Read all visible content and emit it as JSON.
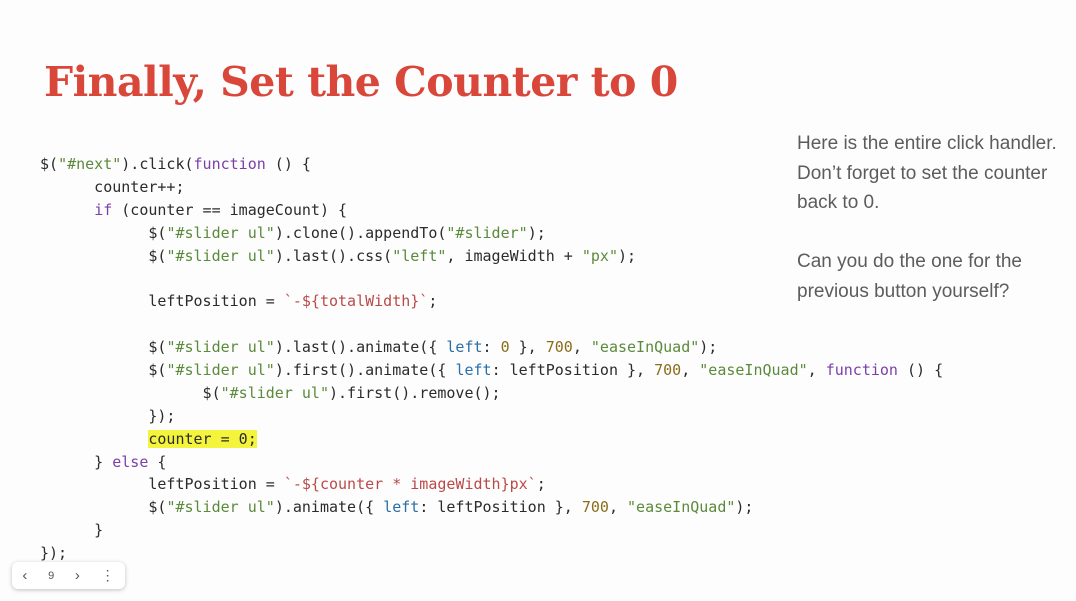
{
  "slide": {
    "title": "Finally, Set the Counter to 0",
    "sidenote": [
      "Here is the entire click handler. Don’t forget to set the counter back to 0.",
      "Can you do the one for the previous button yourself?"
    ],
    "colors": {
      "title": "#d9473a",
      "highlight": "#f4f43c"
    }
  },
  "code": {
    "lines": [
      [
        {
          "t": "$("
        },
        {
          "t": "\"#next\"",
          "c": "str"
        },
        {
          "t": ").click("
        },
        {
          "t": "function",
          "c": "kw"
        },
        {
          "t": " () {"
        }
      ],
      [
        {
          "t": "      counter++;"
        }
      ],
      [
        {
          "t": "      "
        },
        {
          "t": "if",
          "c": "kw"
        },
        {
          "t": " (counter == imageCount) {"
        }
      ],
      [
        {
          "t": "            $("
        },
        {
          "t": "\"#slider ul\"",
          "c": "str"
        },
        {
          "t": ").clone().appendTo("
        },
        {
          "t": "\"#slider\"",
          "c": "str"
        },
        {
          "t": ");"
        }
      ],
      [
        {
          "t": "            $("
        },
        {
          "t": "\"#slider ul\"",
          "c": "str"
        },
        {
          "t": ").last().css("
        },
        {
          "t": "\"left\"",
          "c": "str"
        },
        {
          "t": ", imageWidth + "
        },
        {
          "t": "\"px\"",
          "c": "str"
        },
        {
          "t": ");"
        }
      ],
      [
        {
          "t": ""
        }
      ],
      [
        {
          "t": "            leftPosition = "
        },
        {
          "t": "`-${totalWidth}`",
          "c": "tpl"
        },
        {
          "t": ";"
        }
      ],
      [
        {
          "t": ""
        }
      ],
      [
        {
          "t": "            $("
        },
        {
          "t": "\"#slider ul\"",
          "c": "str"
        },
        {
          "t": ").last().animate({ "
        },
        {
          "t": "left",
          "c": "prop"
        },
        {
          "t": ": "
        },
        {
          "t": "0",
          "c": "num"
        },
        {
          "t": " }, "
        },
        {
          "t": "700",
          "c": "num"
        },
        {
          "t": ", "
        },
        {
          "t": "\"easeInQuad\"",
          "c": "str"
        },
        {
          "t": ");"
        }
      ],
      [
        {
          "t": "            $("
        },
        {
          "t": "\"#slider ul\"",
          "c": "str"
        },
        {
          "t": ").first().animate({ "
        },
        {
          "t": "left",
          "c": "prop"
        },
        {
          "t": ": leftPosition }, "
        },
        {
          "t": "700",
          "c": "num"
        },
        {
          "t": ", "
        },
        {
          "t": "\"easeInQuad\"",
          "c": "str"
        },
        {
          "t": ", "
        },
        {
          "t": "function",
          "c": "kw"
        },
        {
          "t": " () {"
        }
      ],
      [
        {
          "t": "                  $("
        },
        {
          "t": "\"#slider ul\"",
          "c": "str"
        },
        {
          "t": ").first().remove();"
        }
      ],
      [
        {
          "t": "            });"
        }
      ],
      [
        {
          "t": "            "
        },
        {
          "t": "counter = 0;",
          "c": "hl"
        }
      ],
      [
        {
          "t": "      } "
        },
        {
          "t": "else",
          "c": "kw"
        },
        {
          "t": " {"
        }
      ],
      [
        {
          "t": "            leftPosition = "
        },
        {
          "t": "`-${counter * imageWidth}px`",
          "c": "tpl"
        },
        {
          "t": ";"
        }
      ],
      [
        {
          "t": "            $("
        },
        {
          "t": "\"#slider ul\"",
          "c": "str"
        },
        {
          "t": ").animate({ "
        },
        {
          "t": "left",
          "c": "prop"
        },
        {
          "t": ": leftPosition }, "
        },
        {
          "t": "700",
          "c": "num"
        },
        {
          "t": ", "
        },
        {
          "t": "\"easeInQuad\"",
          "c": "str"
        },
        {
          "t": ");"
        }
      ],
      [
        {
          "t": "      }"
        }
      ],
      [
        {
          "t": "});"
        }
      ]
    ]
  },
  "nav": {
    "prev_icon": "chevron-left-icon",
    "prev_glyph": "‹",
    "page": "9",
    "next_icon": "chevron-right-icon",
    "next_glyph": "›",
    "more_icon": "more-vertical-icon",
    "more_glyph": "⋮"
  }
}
